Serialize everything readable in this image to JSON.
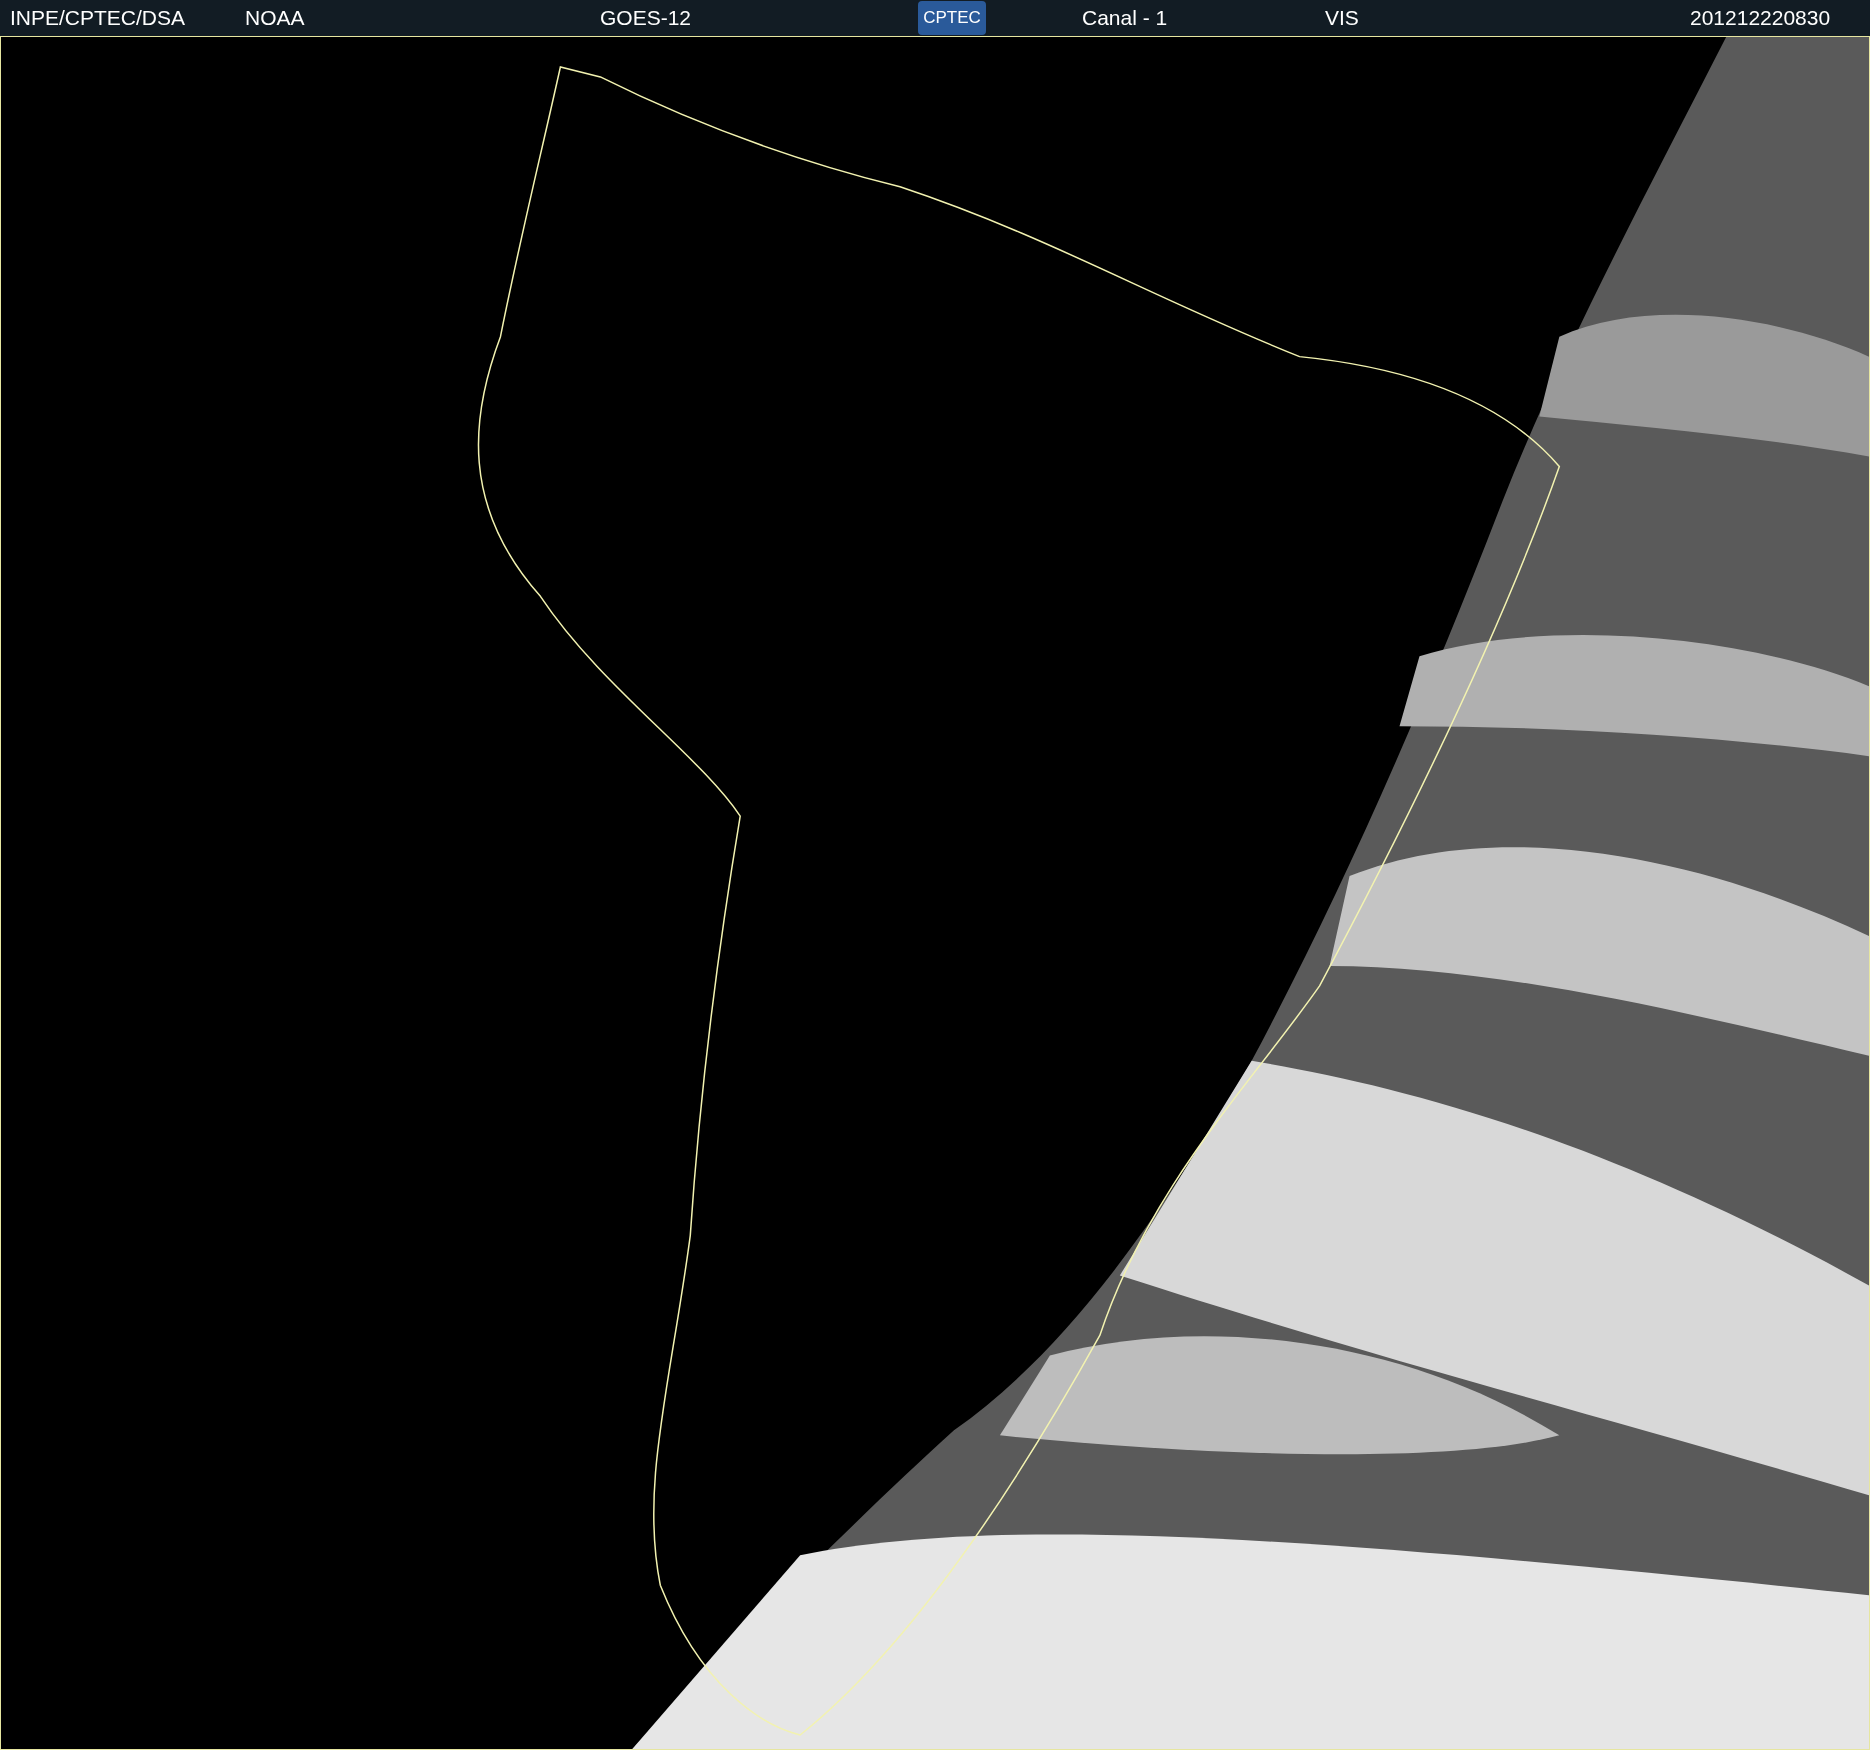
{
  "header": {
    "source": "INPE/CPTEC/DSA",
    "agency": "NOAA",
    "satellite": "GOES-12",
    "logo_text": "CPTEC",
    "channel": "Canal - 1",
    "band": "VIS",
    "timestamp": "201212220830"
  }
}
